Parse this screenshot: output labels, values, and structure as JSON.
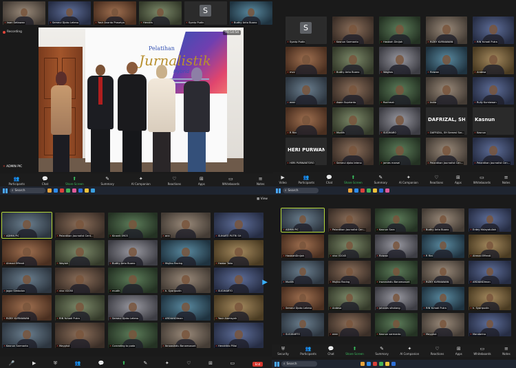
{
  "q1": {
    "strip": [
      {
        "name": "Iwan Setiawan"
      },
      {
        "name": "Semeul Djoko Leteno"
      },
      {
        "name": "Yasir Ananto Prasetyo"
      },
      {
        "name": "Hendris"
      },
      {
        "name": "Syarip Pudin",
        "initial": "S"
      },
      {
        "name": "Budhy Anto Buono"
      }
    ],
    "recording": "Recording",
    "timer": "00:14:54",
    "speaker_label": "ADMIN PIC",
    "banner": {
      "top": "Pelatihan",
      "main": "Jurnalistik",
      "sub": "Hybrid"
    },
    "controls": [
      "Participants",
      "Chat",
      "Share Screen",
      "Summary",
      "AI Companion",
      "Reactions",
      "Apps",
      "Whiteboards",
      "Notes"
    ]
  },
  "q2": {
    "rows": [
      [
        {
          "name": "Syarip Pudin",
          "initial": "S"
        },
        {
          "name": "Kasnun Sarmanto"
        },
        {
          "name": "Hasbiah Dinijah"
        },
        {
          "name": "RIZKY KURNIAWAN"
        },
        {
          "name": "RIN Yuhadi Putra"
        }
      ],
      [
        {
          "name": "mvv"
        },
        {
          "name": "Budhy Anto Buono"
        },
        {
          "name": "Waghos"
        },
        {
          "name": "Ridwan"
        },
        {
          "name": "Andesa"
        }
      ],
      [
        {
          "name": "eeer"
        },
        {
          "name": "Awan Suprianto"
        },
        {
          "name": "Rochmat"
        },
        {
          "name": "Indra"
        },
        {
          "name": "Rully Kurniawan"
        }
      ],
      [
        {
          "name": "R Rini"
        },
        {
          "name": "Mudlih"
        },
        {
          "name": "SUGIHARO"
        },
        {
          "name": "DAFRIZAL, SH Semesl Sar...",
          "big": "DAFRIZAL, SH S..."
        },
        {
          "name": "Kasnun",
          "big": "Kasnun"
        }
      ],
      [
        {
          "name": "HERI PURWANTORO",
          "big": "HERI PURWAN..."
        },
        {
          "name": "Semeul djoko leteno"
        },
        {
          "name": "james marsel"
        },
        {
          "name": "Pelantikan Journalist Cen..."
        },
        {
          "name": "Pelantikan Journalist Cen..."
        }
      ]
    ],
    "controls": [
      "Video",
      "Participants",
      "Chat",
      "Share Screen",
      "Summary",
      "AI Companion",
      "Reactions",
      "Apps",
      "Whiteboards",
      "Notes"
    ]
  },
  "q3": {
    "view_label": "View",
    "rows": [
      [
        {
          "name": "ADMIN PIC",
          "active": true
        },
        {
          "name": "Pelantikan Journalist Cent..."
        },
        {
          "name": "Kinanti 0903"
        },
        {
          "name": "ann"
        },
        {
          "name": "SUHARTI PUTRI SH"
        }
      ],
      [
        {
          "name": "Ahmad Effendi"
        },
        {
          "name": "Waylah"
        },
        {
          "name": "Budhy Anto Buono"
        },
        {
          "name": "Mujibu Racing"
        },
        {
          "name": "Haidar Taka"
        }
      ],
      [
        {
          "name": "jogor Simbolon"
        },
        {
          "name": "vivo V2050"
        },
        {
          "name": "mudlh"
        },
        {
          "name": "h. Syaripudin"
        },
        {
          "name": "SUGIHARTO"
        }
      ],
      [
        {
          "name": "RIZKY KURNIAWAN"
        },
        {
          "name": "RIN Yuhadi Putra"
        },
        {
          "name": "Semeul Djoko Leteno"
        },
        {
          "name": "ARDIANDIman"
        },
        {
          "name": "Yasir Alamsyah"
        }
      ],
      [
        {
          "name": "Kasnun Sarmanto"
        },
        {
          "name": "Mayghut"
        },
        {
          "name": "Conrading to poda"
        },
        {
          "name": "Ibnoosikdiu Banamoaunt"
        },
        {
          "name": "Hendrikto Pillai"
        }
      ]
    ],
    "end_label": "End"
  },
  "q4": {
    "rows": [
      [
        {
          "name": "ADMIN PIC",
          "active": true
        },
        {
          "name": "Pelantikan Journalist Cen..."
        },
        {
          "name": "Kasnun Sara"
        },
        {
          "name": "Budhy Anto Buono"
        },
        {
          "name": "Erdey Hidayatullah"
        }
      ],
      [
        {
          "name": "HasbiahDinijah"
        },
        {
          "name": "vivo V2045"
        },
        {
          "name": "Ridwan"
        },
        {
          "name": "R Rini"
        },
        {
          "name": "Ahmad Effendi"
        }
      ],
      [
        {
          "name": "Mudlih"
        },
        {
          "name": "Mujibu Racing"
        },
        {
          "name": "Irwansikdiu Banamoaunt"
        },
        {
          "name": "RIZKY KURNIAWAN"
        },
        {
          "name": "ARDIANDIman"
        }
      ],
      [
        {
          "name": "Semeul Djoko Leteno"
        },
        {
          "name": "Andesa"
        },
        {
          "name": "johanes sihotang"
        },
        {
          "name": "RIN Yuhadi Putra"
        },
        {
          "name": "h. Syaripudin"
        }
      ],
      [
        {
          "name": "SUGIHARTO"
        },
        {
          "name": "eeer"
        },
        {
          "name": "Kasnun sarmanto"
        },
        {
          "name": "Mayghut"
        },
        {
          "name": "Mandarino"
        }
      ]
    ],
    "controls": [
      "Security",
      "Participants",
      "Chat",
      "Share Screen",
      "Summary",
      "AI Companion",
      "Reactions",
      "Apps",
      "Whiteboards",
      "Notes"
    ]
  },
  "taskbar": {
    "search": "Search"
  },
  "colors": {
    "accent_green": "#3ac05f",
    "active_border": "#b6d93a",
    "mic_red": "#e0463b"
  }
}
